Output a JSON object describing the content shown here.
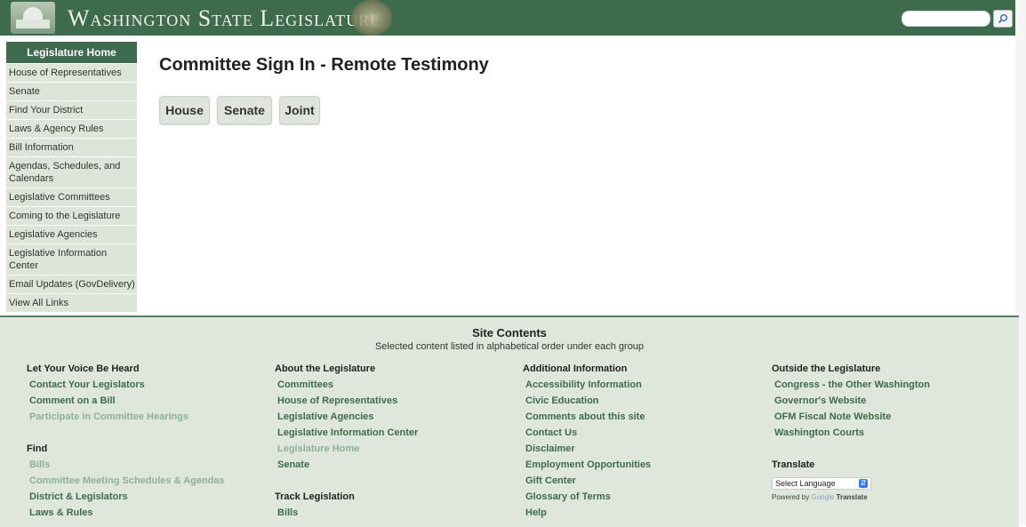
{
  "header": {
    "site_title": "Washington State Legislature",
    "search_placeholder": "",
    "colors": {
      "header_bg": "#3e6b4d",
      "sidebar_bg": "#dde4d9",
      "footer_bg": "#dfe6db",
      "link": "#3e6b4d"
    }
  },
  "sidebar": {
    "home_label": "Legislature Home",
    "items": [
      "House of Representatives",
      "Senate",
      "Find Your District",
      "Laws & Agency Rules",
      "Bill Information",
      "Agendas, Schedules, and Calendars",
      "Legislative Committees",
      "Coming to the Legislature",
      "Legislative Agencies",
      "Legislative Information Center",
      "Email Updates (GovDelivery)",
      "View All Links"
    ]
  },
  "main": {
    "title": "Committee Sign In - Remote Testimony",
    "buttons": [
      "House",
      "Senate",
      "Joint"
    ]
  },
  "footer": {
    "title": "Site Contents",
    "subtitle": "Selected content listed in alphabetical order under each group",
    "col1": {
      "heading": "Let Your Voice Be Heard",
      "links": [
        "Contact Your Legislators",
        "Comment on a Bill",
        "Participate in Committee Hearings"
      ],
      "find_heading": "Find",
      "find_links": [
        "Bills",
        "Committee Meeting Schedules & Agendas",
        "District & Legislators",
        "Laws & Rules"
      ]
    },
    "col2": {
      "heading": "About the Legislature",
      "links": [
        "Committees",
        "House of Representatives",
        "Legislative Agencies",
        "Legislative Information Center",
        "Legislature Home",
        "Senate"
      ],
      "track_heading": "Track Legislation",
      "track_links": [
        "Bills"
      ]
    },
    "col3": {
      "heading": "Additional Information",
      "links": [
        "Accessibility Information",
        "Civic Education",
        "Comments about this site",
        "Contact Us",
        "Disclaimer",
        "Employment Opportunities",
        "Gift Center",
        "Glossary of Terms",
        "Help"
      ]
    },
    "col4": {
      "heading": "Outside the Legislature",
      "links": [
        "Congress - the Other Washington",
        "Governor's Website",
        "OFM Fiscal Note Website",
        "Washington Courts"
      ],
      "translate_heading": "Translate",
      "translate_select": "Select Language",
      "powered_prefix": "Powered by",
      "powered_google": "Google",
      "powered_suffix": "Translate"
    }
  }
}
